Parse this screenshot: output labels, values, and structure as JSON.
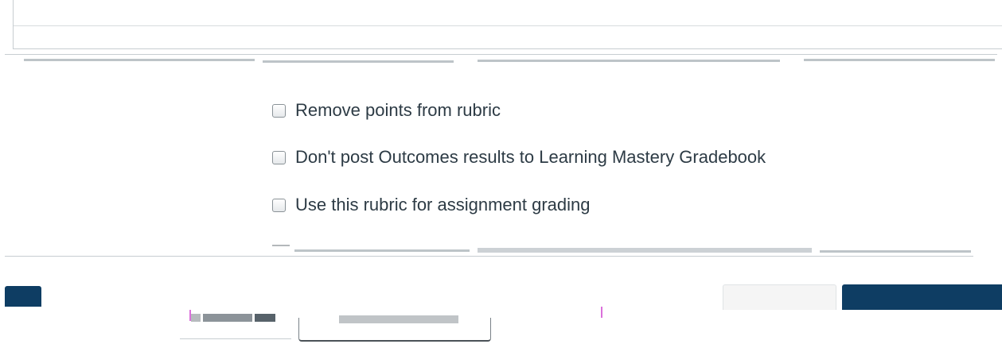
{
  "rubric_options": [
    {
      "label": "Remove points from rubric",
      "checked": false
    },
    {
      "label": "Don't post Outcomes results to Learning Mastery Gradebook",
      "checked": false
    },
    {
      "label": "Use this rubric for assignment grading",
      "checked": false
    }
  ],
  "colors": {
    "primary_button": "#0e3d63",
    "secondary_button": "#f5f5f5",
    "text": "#2d3b45",
    "border": "#c7cdd1"
  }
}
